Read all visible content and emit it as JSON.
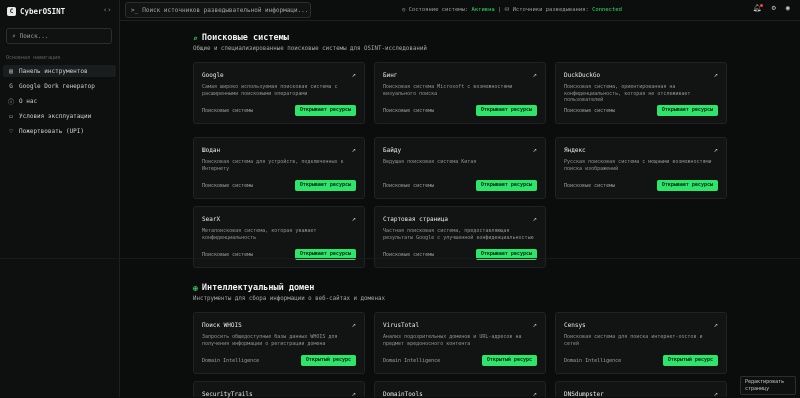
{
  "sidebar": {
    "brand": "CyberOSINT",
    "brand_logo": "C",
    "collapse_icon": "‹›",
    "search_placeholder": "Поиск...",
    "nav_title": "Основная навигация",
    "items": [
      {
        "label": "Панель инструментов",
        "icon": "▤"
      },
      {
        "label": "Google Dork генератор",
        "icon": "G"
      },
      {
        "label": "О нас",
        "icon": "ⓘ"
      },
      {
        "label": "Условия эксплуатации",
        "icon": "▭"
      },
      {
        "label": "Пожертвовать (UPI)",
        "icon": "♡"
      }
    ]
  },
  "topbar": {
    "command_placeholder": "Поиск источников разведывательной информаци...",
    "status_label": "Состояние системы:",
    "status_value": "Активна",
    "sources_label": "Источники разведывания:",
    "sources_value": "Connected"
  },
  "sections": [
    {
      "title": "Поисковые системы",
      "subtitle": "Общие и специализированные поисковые системы для OSINT-исследований",
      "cards": [
        {
          "title": "Google",
          "desc": "Самая широко используемая поисковая система с расширенными поисковыми операторами",
          "category": "Поисковые системы",
          "button": "Открывает ресурсы"
        },
        {
          "title": "Бинг",
          "desc": "Поисковая система Microsoft с возможностями визуального поиска",
          "category": "Поисковые системы",
          "button": "Открывает ресурсы"
        },
        {
          "title": "DuckDuckGo",
          "desc": "Поисковая система, ориентированная на конфиденциальность, которая не отслеживает пользователей",
          "category": "Поисковые системы",
          "button": "Открывает ресурсы"
        },
        {
          "title": "Шодан",
          "desc": "Поисковая система для устройств, подключенных к Интернету",
          "category": "Поисковые системы",
          "button": "Открывает ресурсы"
        },
        {
          "title": "Байду",
          "desc": "Ведущая поисковая система Китая",
          "category": "Поисковые системы",
          "button": "Открывает ресурсы"
        },
        {
          "title": "Яндекс",
          "desc": "Русская поисковая система с мощными возможностями поиска изображений",
          "category": "Поисковые системы",
          "button": "Открывает ресурсы"
        },
        {
          "title": "SearX",
          "desc": "Метапоисковая система, которая уважает конфиденциальность",
          "category": "Поисковые системы",
          "button": "Открывает ресурсы"
        },
        {
          "title": "Стартовая страница",
          "desc": "Частная поисковая система, предоставляющая результаты Google с улучшенной конфиденциальностью",
          "category": "Поисковые системы",
          "button": "Открывает ресурсы"
        }
      ]
    },
    {
      "title": "Интеллектуальный домен",
      "subtitle": "Инструменты для сбора информации о веб-сайтах и доменах",
      "cards": [
        {
          "title": "Поиск WHOIS",
          "desc": "Запросить общедоступные базы данных WHOIS для получения информации о регистрации домена",
          "category": "Domain Intelligence",
          "button": "Открытый ресурс"
        },
        {
          "title": "VirusTotal",
          "desc": "Анализ подозрительных доменов и URL-адресов на предмет вредоносного контента",
          "category": "Domain Intelligence",
          "button": "Открытый ресурс"
        },
        {
          "title": "Censys",
          "desc": "Поисковая система для поиска интернет-хостов и сетей",
          "category": "Domain Intelligence",
          "button": "Открытый ресурс"
        },
        {
          "title": "SecurityTrails",
          "desc": "",
          "category": "",
          "button": ""
        },
        {
          "title": "DomainTools",
          "desc": "",
          "category": "",
          "button": ""
        },
        {
          "title": "DNSdumpster",
          "desc": "",
          "category": "",
          "button": ""
        }
      ]
    }
  ],
  "edit_hint": "Редактировать страницу"
}
